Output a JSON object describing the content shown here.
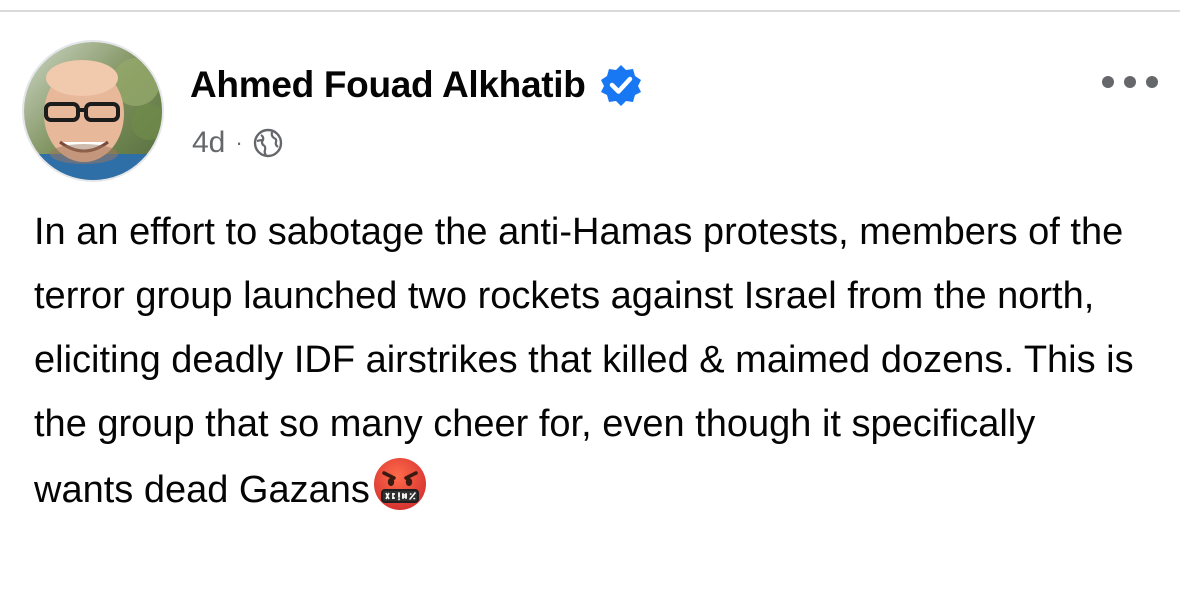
{
  "post": {
    "author_name": "Ahmed Fouad Alkhatib",
    "verified": true,
    "timestamp": "4d",
    "separator": "·",
    "audience_icon": "globe-icon",
    "more_icon": "more-horizontal-icon",
    "text": "In an effort to sabotage the anti-Hamas protests, members of the terror group launched two rockets against Israel from the north, eliciting deadly IDF airstrikes that killed & maimed dozens. This is the group that so many cheer for, even though it specifically wants dead Gazans",
    "trailing_emoji": "face-with-symbols-on-mouth-icon"
  },
  "colors": {
    "verified_blue": "#1877f2",
    "meta_gray": "#65676b",
    "text": "#050505",
    "emoji_face": "#e53935"
  }
}
